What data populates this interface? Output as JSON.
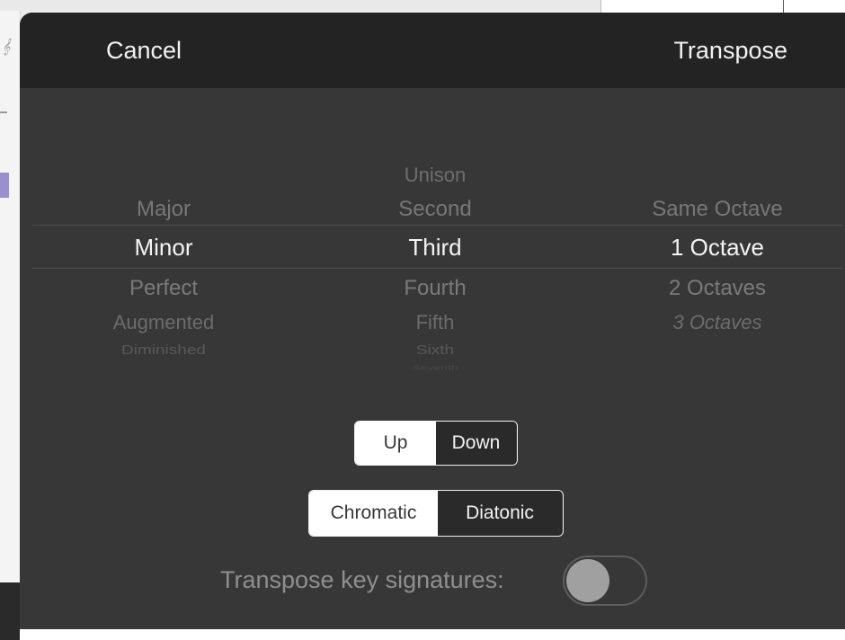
{
  "header": {
    "cancel_label": "Cancel",
    "transpose_label": "Transpose"
  },
  "picker": {
    "quality": {
      "items": [
        "Major",
        "Minor",
        "Perfect",
        "Augmented",
        "Diminished"
      ],
      "selected": "Minor"
    },
    "interval": {
      "items": [
        "Unison",
        "Second",
        "Third",
        "Fourth",
        "Fifth",
        "Sixth",
        "Seventh"
      ],
      "selected": "Third"
    },
    "octave": {
      "items": [
        "Same Octave",
        "1 Octave",
        "2 Octaves",
        "3 Octaves"
      ],
      "selected": "1 Octave"
    }
  },
  "direction": {
    "options": [
      "Up",
      "Down"
    ],
    "selected": "Up"
  },
  "mode": {
    "options": [
      "Chromatic",
      "Diatonic"
    ],
    "selected": "Chromatic"
  },
  "key_signatures": {
    "label": "Transpose key signatures:",
    "enabled": false
  },
  "colors": {
    "sheet_bg": "#373737",
    "navbar_bg": "#232323",
    "selected_text": "#f4f4f4",
    "dim_text": "#777777",
    "toggle_off": "#a0a0a0"
  }
}
